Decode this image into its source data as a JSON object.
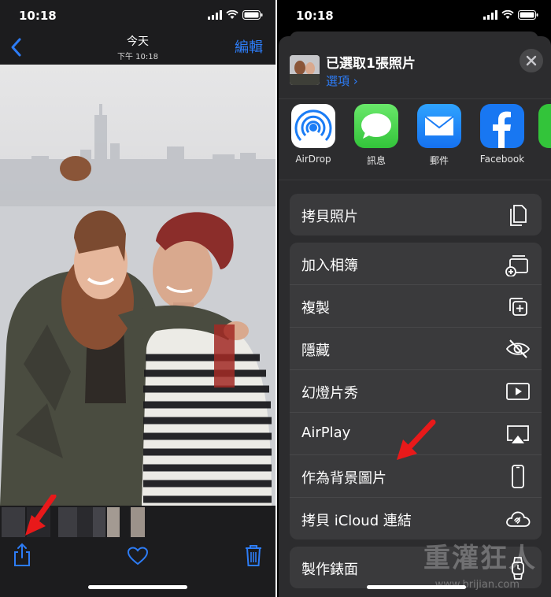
{
  "left": {
    "status": {
      "time": "10:18"
    },
    "nav": {
      "title": "今天",
      "subtitle": "下午 10:18",
      "edit_label": "編輯"
    }
  },
  "right": {
    "status": {
      "time": "10:18"
    },
    "header": {
      "title": "已選取1張照片",
      "options_label": "選項 ›"
    },
    "apps": [
      {
        "label": "AirDrop"
      },
      {
        "label": "訊息"
      },
      {
        "label": "郵件"
      },
      {
        "label": "Facebook"
      }
    ],
    "actions": [
      {
        "label": "拷貝照片",
        "icon": "copy-icon"
      },
      {
        "label": "加入相簿",
        "icon": "add-to-album-icon"
      },
      {
        "label": "複製",
        "icon": "duplicate-icon"
      },
      {
        "label": "隱藏",
        "icon": "hide-eye-icon"
      },
      {
        "label": "幻燈片秀",
        "icon": "slideshow-play-icon"
      },
      {
        "label": "AirPlay",
        "icon": "airplay-icon"
      },
      {
        "label": "作為背景圖片",
        "icon": "iphone-icon"
      },
      {
        "label": "拷貝 iCloud 連結",
        "icon": "icloud-link-icon"
      },
      {
        "label": "製作錶面",
        "icon": "watch-icon"
      }
    ],
    "watermark": {
      "title": "重灌狂人",
      "url": "www.brijian.com"
    }
  },
  "colors": {
    "accent": "#2d7cf6",
    "annotation_arrow": "#e8191a"
  }
}
